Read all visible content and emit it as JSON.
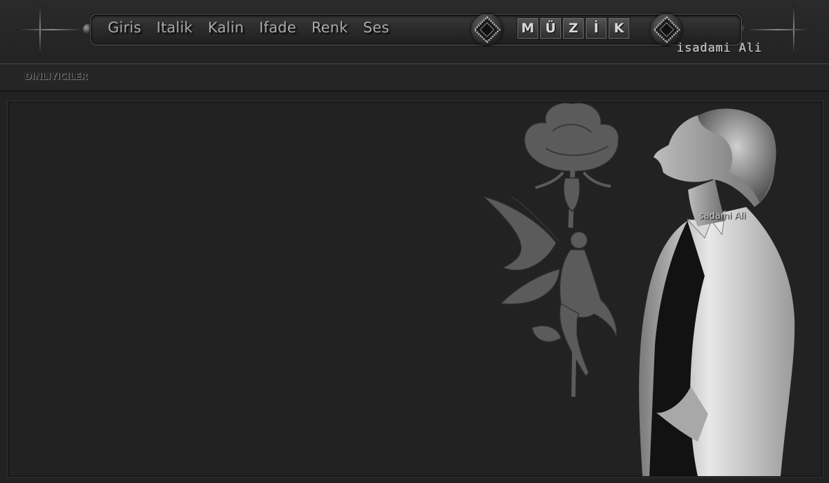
{
  "menu": {
    "items": [
      "Giris",
      "Italik",
      "Kalin",
      "Ifade",
      "Renk",
      "Ses"
    ]
  },
  "music": {
    "letters": [
      "M",
      "Ü",
      "Z",
      "İ",
      "K"
    ]
  },
  "brand": {
    "signature": "isadami Ali",
    "photo_signature": "sadami Ali"
  },
  "listeners": {
    "label": "DINLIYICILER"
  },
  "icons": {
    "left_ornament": "crosshair-ornament-icon",
    "right_ornament": "crosshair-ornament-icon",
    "music_left": "diamond-emblem-icon",
    "music_right": "diamond-emblem-icon"
  },
  "colors": {
    "background": "#232223",
    "text": "#a9a9a9",
    "accent": "#d8d8d8"
  }
}
